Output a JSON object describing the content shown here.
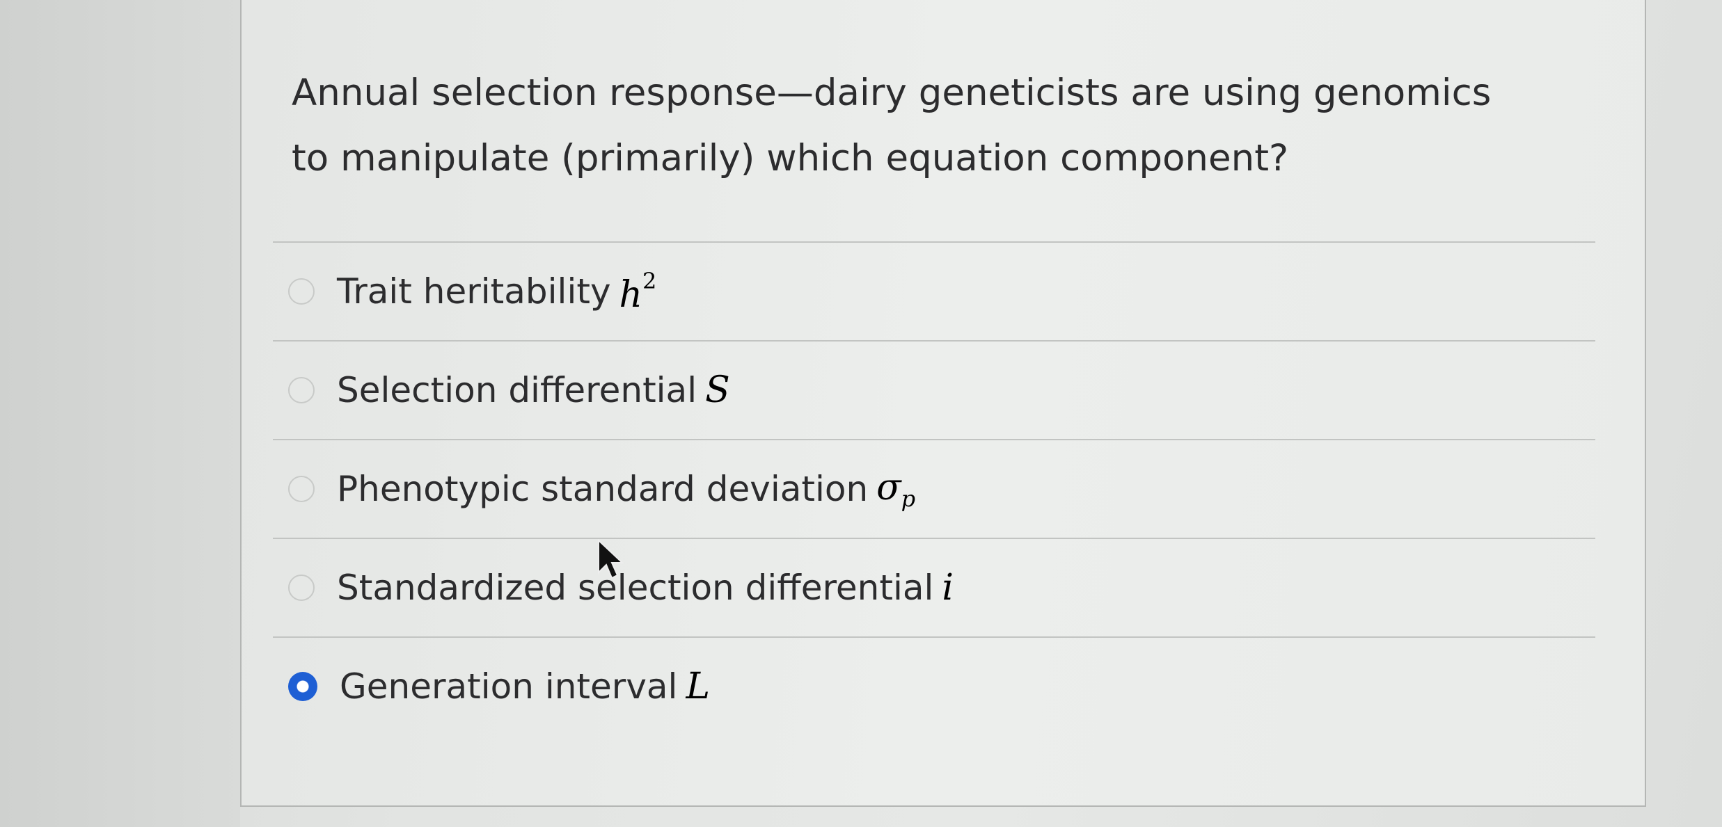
{
  "question": {
    "line1": "Annual selection response—dairy geneticists are using genomics",
    "line2": "to manipulate (primarily) which equation component?"
  },
  "options": [
    {
      "label": "Trait heritability",
      "symbol": "h",
      "sup": "2",
      "sub": "",
      "checked": false
    },
    {
      "label": "Selection differential",
      "symbol": "S",
      "sup": "",
      "sub": "",
      "checked": false
    },
    {
      "label": "Phenotypic standard deviation",
      "symbol": "σ",
      "sup": "",
      "sub": "p",
      "checked": false
    },
    {
      "label": "Standardized selection differential",
      "symbol": "i",
      "sup": "",
      "sub": "",
      "checked": false
    },
    {
      "label": "Generation interval",
      "symbol": "L",
      "sup": "",
      "sub": "",
      "checked": true
    }
  ],
  "icons": {
    "radio_unchecked": "radio-unchecked-icon",
    "radio_checked": "radio-checked-icon",
    "cursor": "mouse-pointer-icon"
  },
  "colors": {
    "accent": "#1e5fd4",
    "text": "#2c2c2e",
    "divider": "#c2c4c2"
  }
}
